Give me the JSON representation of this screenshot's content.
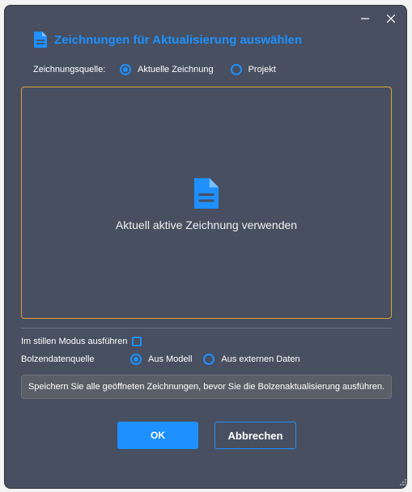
{
  "window": {
    "minimize_icon": "minimize-icon",
    "close_icon": "close-icon"
  },
  "dialog": {
    "title": "Zeichnungen für Aktualisierung auswählen",
    "title_icon": "document-icon",
    "accent_color": "#1e90ff",
    "highlight_border_color": "#e0a030"
  },
  "drawing_source": {
    "label": "Zeichnungsquelle:",
    "options": [
      {
        "label": "Aktuelle Zeichnung",
        "selected": true
      },
      {
        "label": "Projekt",
        "selected": false
      }
    ]
  },
  "preview": {
    "icon": "document-icon",
    "text": "Aktuell aktive Zeichnung verwenden"
  },
  "silent_mode": {
    "label": "Im stillen Modus ausführen",
    "checked": false
  },
  "bolt_source": {
    "label": "Bolzendatenquelle",
    "options": [
      {
        "label": "Aus Modell",
        "selected": true
      },
      {
        "label": "Aus externen Daten",
        "selected": false
      }
    ]
  },
  "note": "Speichern Sie alle geöffneten Zeichnungen, bevor Sie die Bolzenaktualisierung ausführen.",
  "buttons": {
    "ok": "OK",
    "cancel": "Abbrechen"
  }
}
